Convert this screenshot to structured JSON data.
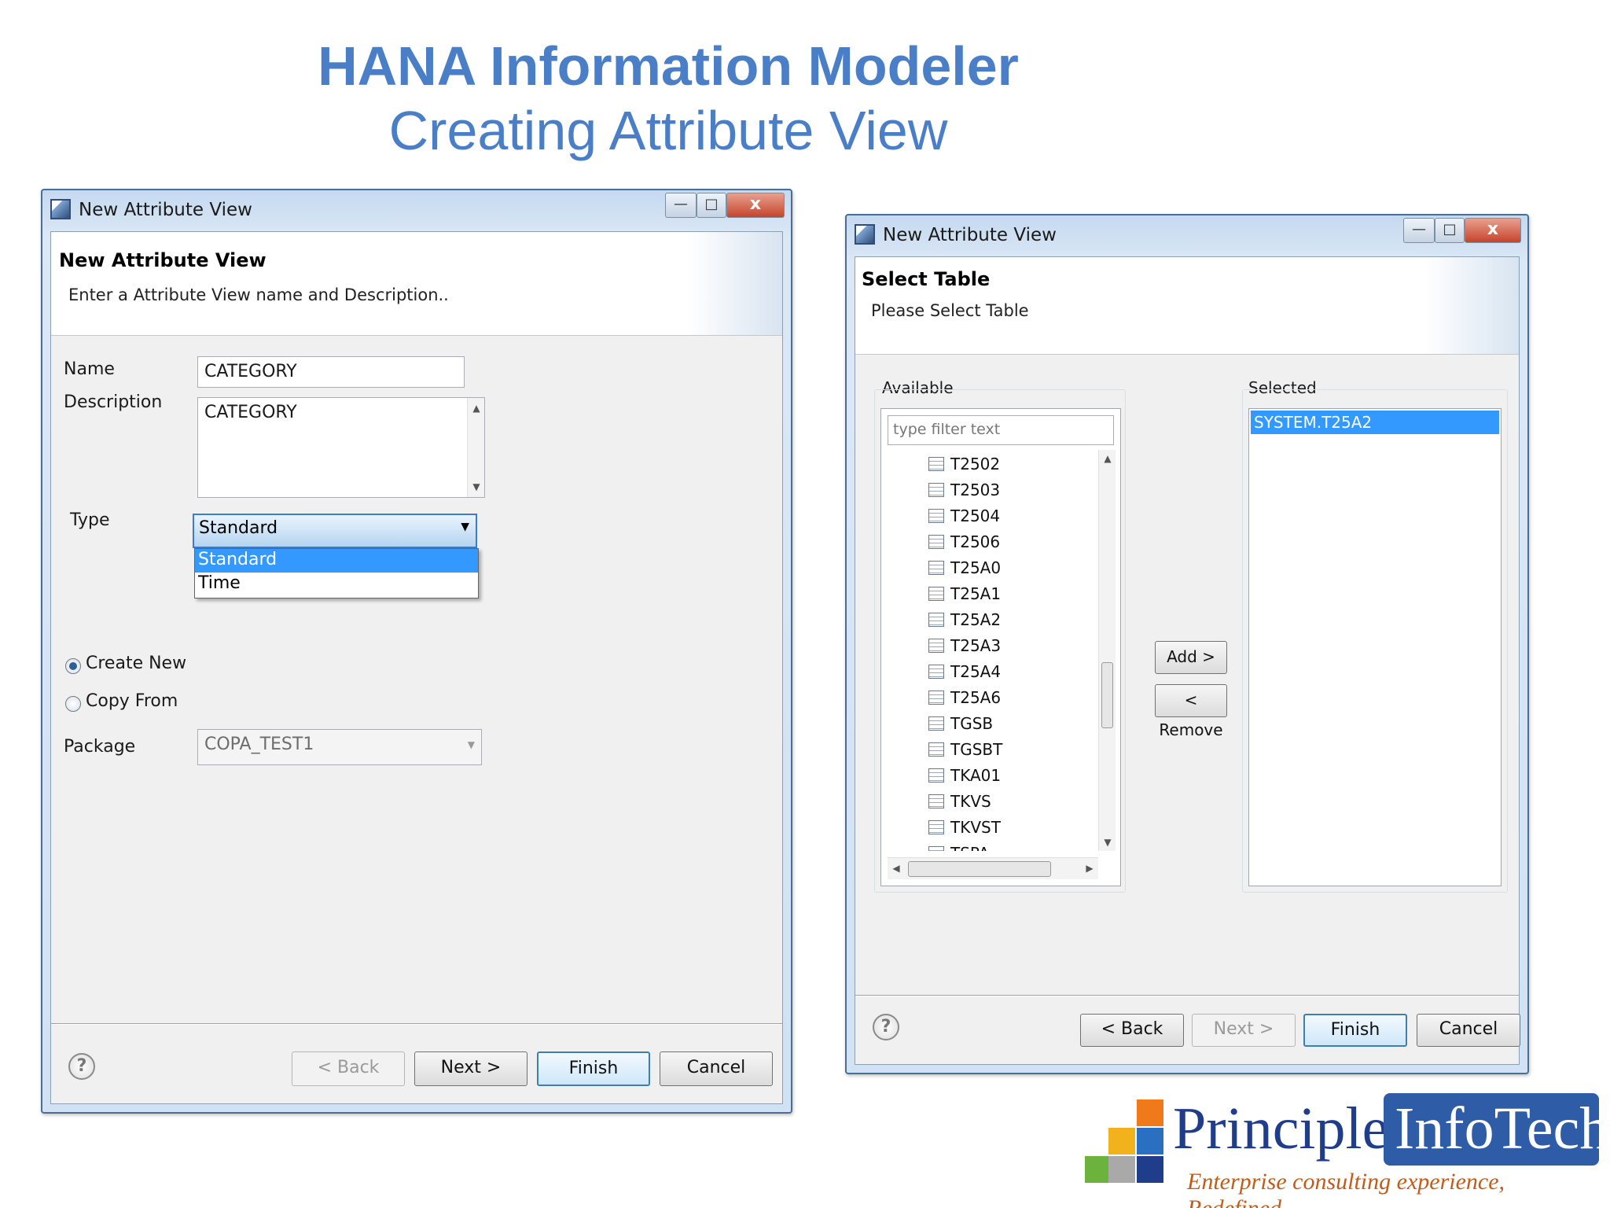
{
  "slide": {
    "title": "HANA Information Modeler",
    "subtitle": "Creating Attribute View"
  },
  "dialog1": {
    "window_title": "New Attribute View",
    "header_title": "New Attribute View",
    "header_subtitle": "Enter a Attribute View name and Description..",
    "name_label": "Name",
    "name_value": "CATEGORY",
    "description_label": "Description",
    "description_value": "CATEGORY",
    "type_label": "Type",
    "type_value": "Standard",
    "type_options": [
      "Standard",
      "Time"
    ],
    "create_new_label": "Create New",
    "copy_from_label": "Copy From",
    "package_label": "Package",
    "package_value": "COPA_TEST1",
    "buttons": {
      "back": "< Back",
      "next": "Next >",
      "finish": "Finish",
      "cancel": "Cancel"
    }
  },
  "dialog2": {
    "window_title": "New Attribute View",
    "header_title": "Select Table",
    "header_subtitle": "Please Select Table",
    "available_label": "Available",
    "filter_placeholder": "type filter text",
    "tables": [
      "T2502",
      "T2503",
      "T2504",
      "T2506",
      "T25A0",
      "T25A1",
      "T25A2",
      "T25A3",
      "T25A4",
      "T25A6",
      "TGSB",
      "TGSBT",
      "TKA01",
      "TKVS",
      "TKVST",
      "TSPA"
    ],
    "selected_label": "Selected",
    "selected_items": [
      "SYSTEM.T25A2"
    ],
    "add_label": "Add >",
    "remove_label": "< Remove",
    "buttons": {
      "back": "< Back",
      "next": "Next >",
      "finish": "Finish",
      "cancel": "Cancel"
    }
  },
  "logo": {
    "word1": "Principle",
    "word2": "InfoTech",
    "tagline": "Enterprise consulting experience, Redefined..."
  },
  "colors": {
    "title_blue": "#4a7fc8",
    "selection_blue": "#3399ff",
    "logo_navy": "#1f3d8a",
    "logo_orange": "#c45b16"
  }
}
